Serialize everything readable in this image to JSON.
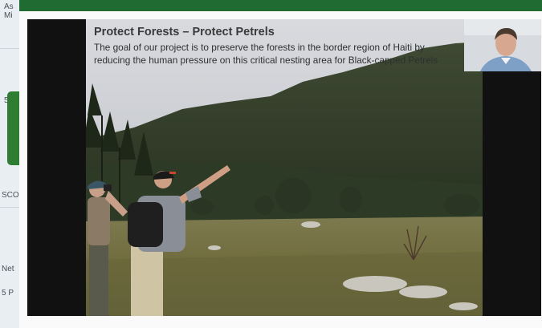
{
  "background_app": {
    "fragments": [
      "As",
      "Mi",
      "5",
      "SCO",
      "Net",
      "5 P"
    ]
  },
  "slide": {
    "title": "Protect Forests – Protect Petrels",
    "body": "The goal of our project is to preserve the forests in the border region of Haiti by reducing the human pressure on this critical nesting area for Black-capped Petrels"
  },
  "colors": {
    "modal_topbar": "#1f6b32",
    "video_background": "#111111",
    "bg_card_green": "#2e7d32"
  }
}
